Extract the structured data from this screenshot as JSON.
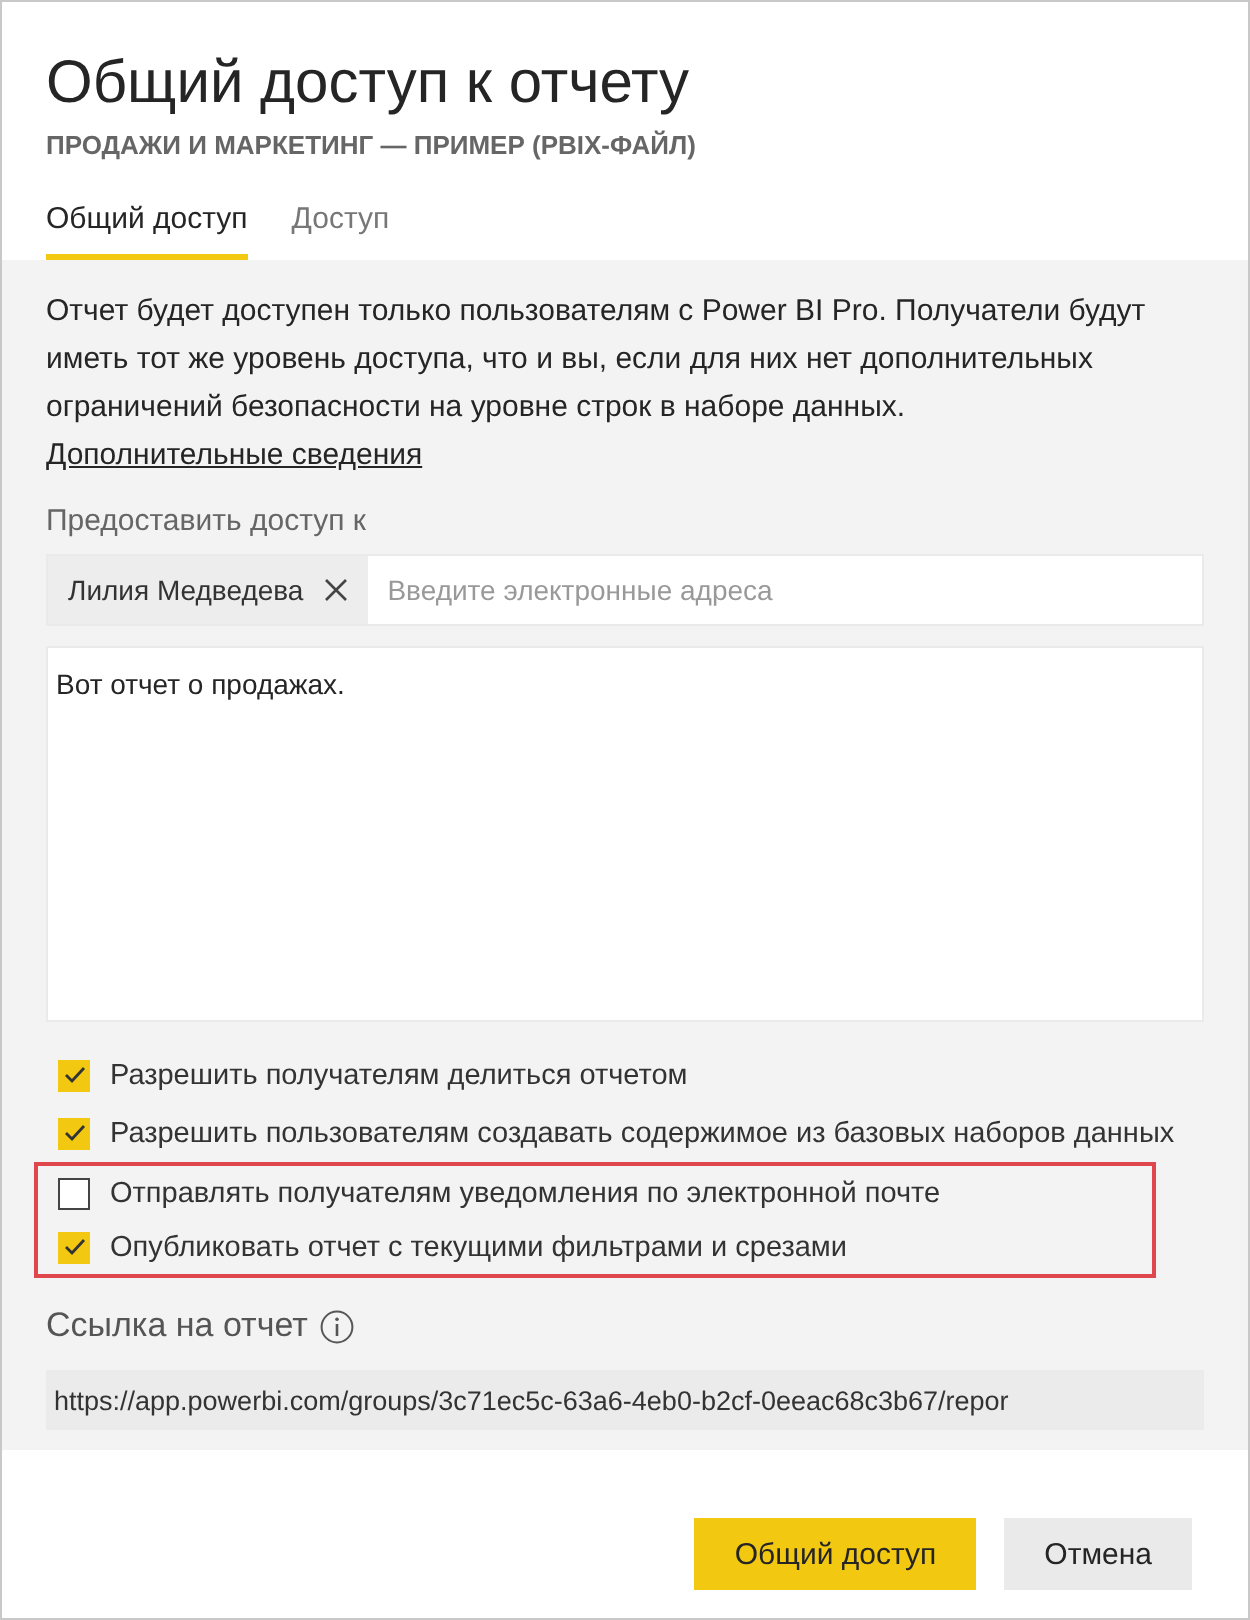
{
  "dialog": {
    "title": "Общий доступ к отчету",
    "subtitle": "ПРОДАЖИ И МАРКЕТИНГ — ПРИМЕР (PBIX-ФАЙЛ)"
  },
  "tabs": [
    {
      "label": "Общий доступ",
      "selected": true
    },
    {
      "label": "Доступ",
      "selected": false
    }
  ],
  "info": {
    "text": "Отчет будет доступен только пользователям с Power BI Pro. Получатели будут иметь тот же уровень доступа, что и вы, если для них нет дополнительных ограничений безопасности на уровне строк в наборе данных.",
    "link": "Дополнительные сведения"
  },
  "recipients": {
    "label": "Предоставить доступ к",
    "chips": [
      "Лилия Медведева"
    ],
    "placeholder": "Введите электронные адреса"
  },
  "message": {
    "value": "Вот отчет о продажах."
  },
  "options": [
    {
      "label": "Разрешить получателям делиться отчетом",
      "checked": true,
      "highlighted": false
    },
    {
      "label": "Разрешить пользователям создавать содержимое из базовых наборов данных",
      "checked": true,
      "highlighted": false
    },
    {
      "label": "Отправлять получателям уведомления по электронной почте",
      "checked": false,
      "highlighted": true
    },
    {
      "label": "Опубликовать отчет с текущими фильтрами и срезами",
      "checked": true,
      "highlighted": true
    }
  ],
  "report_link": {
    "label": "Ссылка на отчет",
    "value": "https://app.powerbi.com/groups/3c71ec5c-63a6-4eb0-b2cf-0eeac68c3b67/repor"
  },
  "buttons": [
    {
      "label": "Общий доступ",
      "kind": "primary"
    },
    {
      "label": "Отмена",
      "kind": "secondary"
    }
  ]
}
